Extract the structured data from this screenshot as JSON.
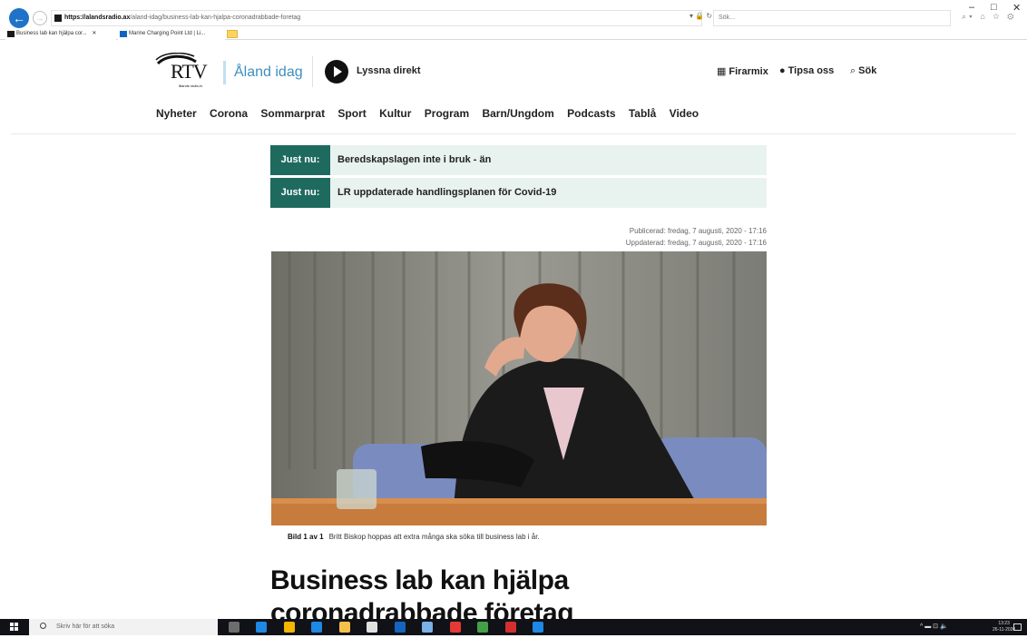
{
  "browser": {
    "url_host": "https://alandsradio.ax",
    "url_path": "/aland-idag/business-lab-kan-hjalpa-coronadrabbade-foretag",
    "address_icons": "▾ 🔒 ↻",
    "search_placeholder": "Sök...",
    "window_controls": [
      "–",
      "□",
      "✕"
    ],
    "tool_icons": "⌕▾ ⌂ ☆ ⚙",
    "tabs": [
      {
        "label": "Business lab kan hjälpa cor...",
        "close": "✕"
      },
      {
        "label": "Marine Charging Point Ltd | Li..."
      }
    ]
  },
  "site": {
    "logo_name": "RTV",
    "logo_sub": "ålands radio-tv",
    "logo_text": "Åland idag",
    "listen_label": "Lyssna direkt",
    "header_links": [
      {
        "icon": "building-icon",
        "glyph": "▦",
        "label": "Firarmix"
      },
      {
        "icon": "speech-bubble-icon",
        "glyph": "●",
        "label": "Tipsa oss"
      },
      {
        "icon": "search-icon",
        "glyph": "⌕",
        "label": "Sök"
      }
    ],
    "nav": [
      "Nyheter",
      "Corona",
      "Sommarprat",
      "Sport",
      "Kultur",
      "Program",
      "Barn/Ungdom",
      "Podcasts",
      "Tablå",
      "Video"
    ]
  },
  "breaking": [
    {
      "label": "Just nu:",
      "text": "Beredskapslagen inte i bruk - än"
    },
    {
      "label": "Just nu:",
      "text": "LR uppdaterade handlingsplanen för Covid-19"
    }
  ],
  "article": {
    "published": "Publicerad: fredag, 7 augusti, 2020 - 17:16",
    "updated": "Uppdaterad: fredag, 7 augusti, 2020 - 17:16",
    "image_counter": "Bild 1 av 1",
    "caption": "Britt Biskop hoppas att extra många ska söka till business lab i år.",
    "headline": "Business lab kan hjälpa coronadrabbade företag"
  },
  "taskbar": {
    "search_placeholder": "Skriv här för att söka",
    "tray": "^ ▬ ⊡ 🔈",
    "time": "13:23",
    "date": "26-11-2020",
    "app_colors": [
      "#6d6d6d",
      "#1e88e5",
      "#f4b400",
      "#1e88e5",
      "#f5c04a",
      "#e0e0e0",
      "#1565c0",
      "#7bb0e8",
      "#e53935",
      "#43a047",
      "#d32f2f",
      "#1e88e5"
    ]
  },
  "colors": {
    "accent_green": "#1f6a5f",
    "ticker_bg": "#e8f3ef",
    "logo_blue": "#3d8fbf"
  }
}
